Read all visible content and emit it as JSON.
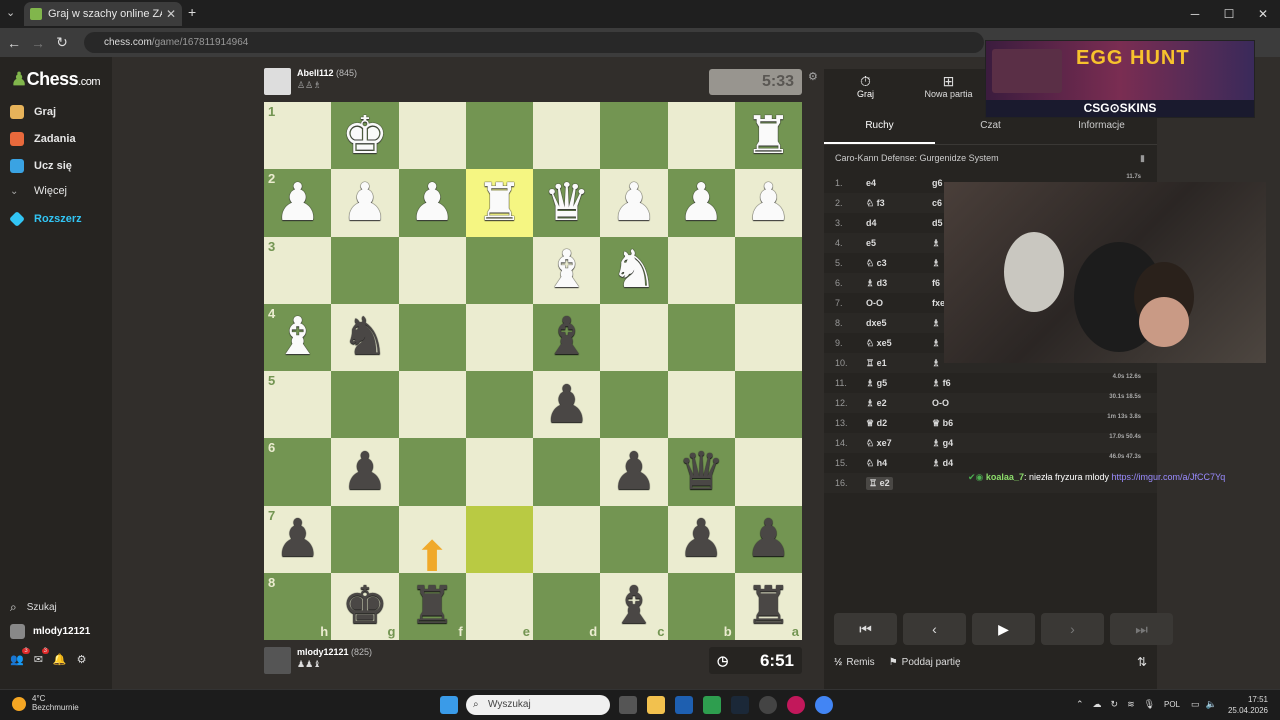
{
  "browser": {
    "tab_title": "Graj w szachy online ZA DARMO",
    "url_domain": "chess.com",
    "url_path": "/game/167811914964"
  },
  "sidebar": {
    "logo": "Chess",
    "logo_suffix": ".com",
    "items": [
      {
        "label": "Graj",
        "color": "#e7b35a"
      },
      {
        "label": "Zadania",
        "color": "#e8693c"
      },
      {
        "label": "Ucz się",
        "color": "#3aa3e3"
      },
      {
        "label": "Więcej",
        "color": "#aaaaaa"
      },
      {
        "label": "Rozszerz",
        "color": "#32c5f4"
      }
    ],
    "search": "Szukaj",
    "username": "mlody12121",
    "badge_friends": "3",
    "badge_messages": "3"
  },
  "top_player": {
    "name": "Abell112",
    "rating": "(845)"
  },
  "bottom_player": {
    "name": "mlody12121",
    "rating": "(825)"
  },
  "clocks": {
    "top": "5:33",
    "bottom": "6:51"
  },
  "board": {
    "ranks": [
      "1",
      "2",
      "3",
      "4",
      "5",
      "6",
      "7",
      "8"
    ],
    "files": [
      "h",
      "g",
      "f",
      "e",
      "d",
      "c",
      "b",
      "a"
    ],
    "pieces": [
      [
        "",
        "wK",
        "",
        "",
        "",
        "",
        "",
        "wR"
      ],
      [
        "wP",
        "wP",
        "wP",
        "wR",
        "wQ",
        "wP",
        "wP",
        "wP"
      ],
      [
        "",
        "",
        "",
        "",
        "wB",
        "wN",
        "",
        ""
      ],
      [
        "wB",
        "bN",
        "",
        "",
        "bB",
        "",
        "",
        ""
      ],
      [
        "",
        "",
        "",
        "",
        "bP",
        "",
        "",
        ""
      ],
      [
        "",
        "bP",
        "",
        "",
        "",
        "bP",
        "bQ",
        ""
      ],
      [
        "bP",
        "",
        "",
        "",
        "",
        "",
        "bP",
        "bP"
      ],
      [
        "",
        "bK",
        "bR",
        "",
        "",
        "bB",
        "",
        "bR"
      ]
    ]
  },
  "panel": {
    "top_buttons": [
      "Graj",
      "Nowa partia"
    ],
    "tabs": [
      "Ruchy",
      "Czat",
      "Informacje"
    ],
    "opening": "Caro-Kann Defense: Gurgenidze System",
    "moves": [
      {
        "n": "1.",
        "w": "e4",
        "b": "g6",
        "t": "11.7s"
      },
      {
        "n": "2.",
        "w": "♘ f3",
        "b": "c6",
        "t": ""
      },
      {
        "n": "3.",
        "w": "d4",
        "b": "d5",
        "t": ""
      },
      {
        "n": "4.",
        "w": "e5",
        "b": "♗",
        "t": ""
      },
      {
        "n": "5.",
        "w": "♘ c3",
        "b": "♗",
        "t": ""
      },
      {
        "n": "6.",
        "w": "♗ d3",
        "b": "f6",
        "t": ""
      },
      {
        "n": "7.",
        "w": "O-O",
        "b": "fxe",
        "t": ""
      },
      {
        "n": "8.",
        "w": "dxe5",
        "b": "♗",
        "t": ""
      },
      {
        "n": "9.",
        "w": "♘ xe5",
        "b": "♗",
        "t": ""
      },
      {
        "n": "10.",
        "w": "♖ e1",
        "b": "♗",
        "t": "6.8s"
      },
      {
        "n": "11.",
        "w": "♗ g5",
        "b": "♗ f6",
        "t": "4.0s 12.6s"
      },
      {
        "n": "12.",
        "w": "♗ e2",
        "b": "O-O",
        "t": "30.1s 18.5s"
      },
      {
        "n": "13.",
        "w": "♕ d2",
        "b": "♕ b6",
        "t": "1m 13s 3.8s"
      },
      {
        "n": "14.",
        "w": "♘ xe7",
        "b": "♗ g4",
        "t": "17.0s 50.4s"
      },
      {
        "n": "15.",
        "w": "♘ h4",
        "b": "♗ d4",
        "t": "46.0s 47.3s"
      },
      {
        "n": "16.",
        "w": "♖ e2",
        "b": "",
        "t": ""
      }
    ],
    "draw": "Remis",
    "resign": "Poddaj partię"
  },
  "ad": {
    "title": "EGG HUNT",
    "brand": "CSG⊙SKINS"
  },
  "chat_overlay": {
    "user": "koalaa_7",
    "text": ": niezła fryzura mlody",
    "link": "https://imgur.com/a/JfCC7Yq"
  },
  "taskbar": {
    "temp": "4°C",
    "weather": "Bezchmurnie",
    "search": "Wyszukaj",
    "lang": "POL",
    "time": "17:51",
    "date": "25.04.2026"
  }
}
